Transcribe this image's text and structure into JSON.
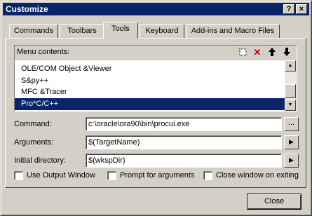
{
  "window": {
    "title": "Customize",
    "help_label": "?",
    "close_label": "×"
  },
  "tabs": [
    {
      "label": "Commands"
    },
    {
      "label": "Toolbars"
    },
    {
      "label": "Tools",
      "active": true
    },
    {
      "label": "Keyboard"
    },
    {
      "label": "Add-ins and Macro Files"
    }
  ],
  "menu": {
    "label": "Menu contents:",
    "icons": [
      "new-item-icon",
      "delete-icon",
      "move-up-icon",
      "move-down-icon"
    ],
    "items": [
      "OLE/COM Object &Viewer",
      "S&py++",
      "MFC &Tracer",
      "Pro*C/C++"
    ],
    "selected_index": 3
  },
  "fields": {
    "command_label": "Command:",
    "command_value": "c:\\oracle\\ora90\\bin\\procui.exe",
    "browse_label": "...",
    "arguments_label": "Arguments:",
    "arguments_value": "$(TargetName)",
    "initial_dir_label": "Initial directory:",
    "initial_dir_value": "$(wkspDir)"
  },
  "options": {
    "use_output_window": "Use Output Window",
    "prompt_for_arguments": "Prompt for arguments",
    "close_window_on_exiting": "Close window on exiting"
  },
  "footer": {
    "close_label": "Close"
  }
}
